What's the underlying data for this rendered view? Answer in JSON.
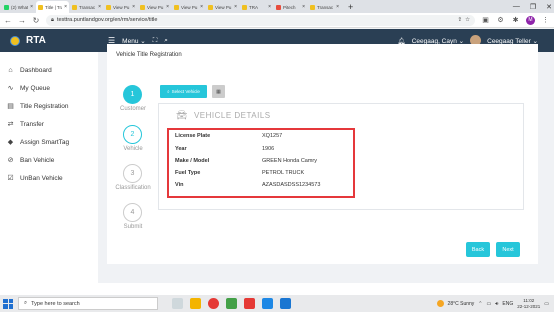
{
  "browser": {
    "tabs": [
      {
        "label": "(2) Whats",
        "active": false,
        "color": "#25d366"
      },
      {
        "label": "Title | Tra",
        "active": true,
        "color": "#f0c020"
      },
      {
        "label": "Transac",
        "active": false,
        "color": "#f0c020"
      },
      {
        "label": "View Pu",
        "active": false,
        "color": "#f0c020"
      },
      {
        "label": "View Pu",
        "active": false,
        "color": "#f0c020"
      },
      {
        "label": "View Pu",
        "active": false,
        "color": "#f0c020"
      },
      {
        "label": "View Pu",
        "active": false,
        "color": "#f0c020"
      },
      {
        "label": "TRA",
        "active": false,
        "color": "#f0c020"
      },
      {
        "label": "Pitech",
        "active": false,
        "color": "#e74c3c"
      },
      {
        "label": "Transac",
        "active": false,
        "color": "#f0c020"
      }
    ],
    "new_tab": "+",
    "url": "testtra.puntlandgov.org/en/rm/service/title",
    "profile_initial": "M"
  },
  "app": {
    "brand": "RTA",
    "menu_label": "Menu",
    "user_name": "Ceegaag, Cayn",
    "user_role": "Ceegaag Teller"
  },
  "sidebar": {
    "items": [
      {
        "label": "Dashboard",
        "icon": "home-icon",
        "glyph": "⌂"
      },
      {
        "label": "My Queue",
        "icon": "activity-icon",
        "glyph": "∿"
      },
      {
        "label": "Title Registration",
        "icon": "document-icon",
        "glyph": "▤"
      },
      {
        "label": "Transfer",
        "icon": "transfer-icon",
        "glyph": "⇄"
      },
      {
        "label": "Assign SmartTag",
        "icon": "tag-icon",
        "glyph": "◆"
      },
      {
        "label": "Ban Vehicle",
        "icon": "ban-icon",
        "glyph": "⊘"
      },
      {
        "label": "UnBan Vehicle",
        "icon": "checkbox-icon",
        "glyph": "☑"
      }
    ]
  },
  "page": {
    "title": "Vehicle Title Registration",
    "steps": [
      {
        "number": "1",
        "label": "Customer",
        "state": "active"
      },
      {
        "number": "2",
        "label": "Vehicle",
        "state": "done"
      },
      {
        "number": "3",
        "label": "Classification",
        "state": "todo"
      },
      {
        "number": "4",
        "label": "Submit",
        "state": "todo"
      }
    ],
    "select_vehicle_label": "Select Vehicle",
    "details_title": "VEHICLE DETAILS",
    "details": [
      {
        "key": "License Plate",
        "value": "XQ1257"
      },
      {
        "key": "Year",
        "value": "1906"
      },
      {
        "key": "Make / Model",
        "value": "GREEN Honda Camry"
      },
      {
        "key": "Fuel Type",
        "value": "PETROL TRUCK"
      },
      {
        "key": "Vin",
        "value": "AZASDASDSS1234573"
      }
    ],
    "back_label": "Back",
    "next_label": "Next"
  },
  "taskbar": {
    "search_placeholder": "Type here to search",
    "weather": "28°C Sunny",
    "language": "ENG",
    "time": "11:02",
    "date": "22-12-2021"
  },
  "colors": {
    "accent": "#26c6da",
    "header": "#2a3f54",
    "highlight": "#e5383b"
  }
}
